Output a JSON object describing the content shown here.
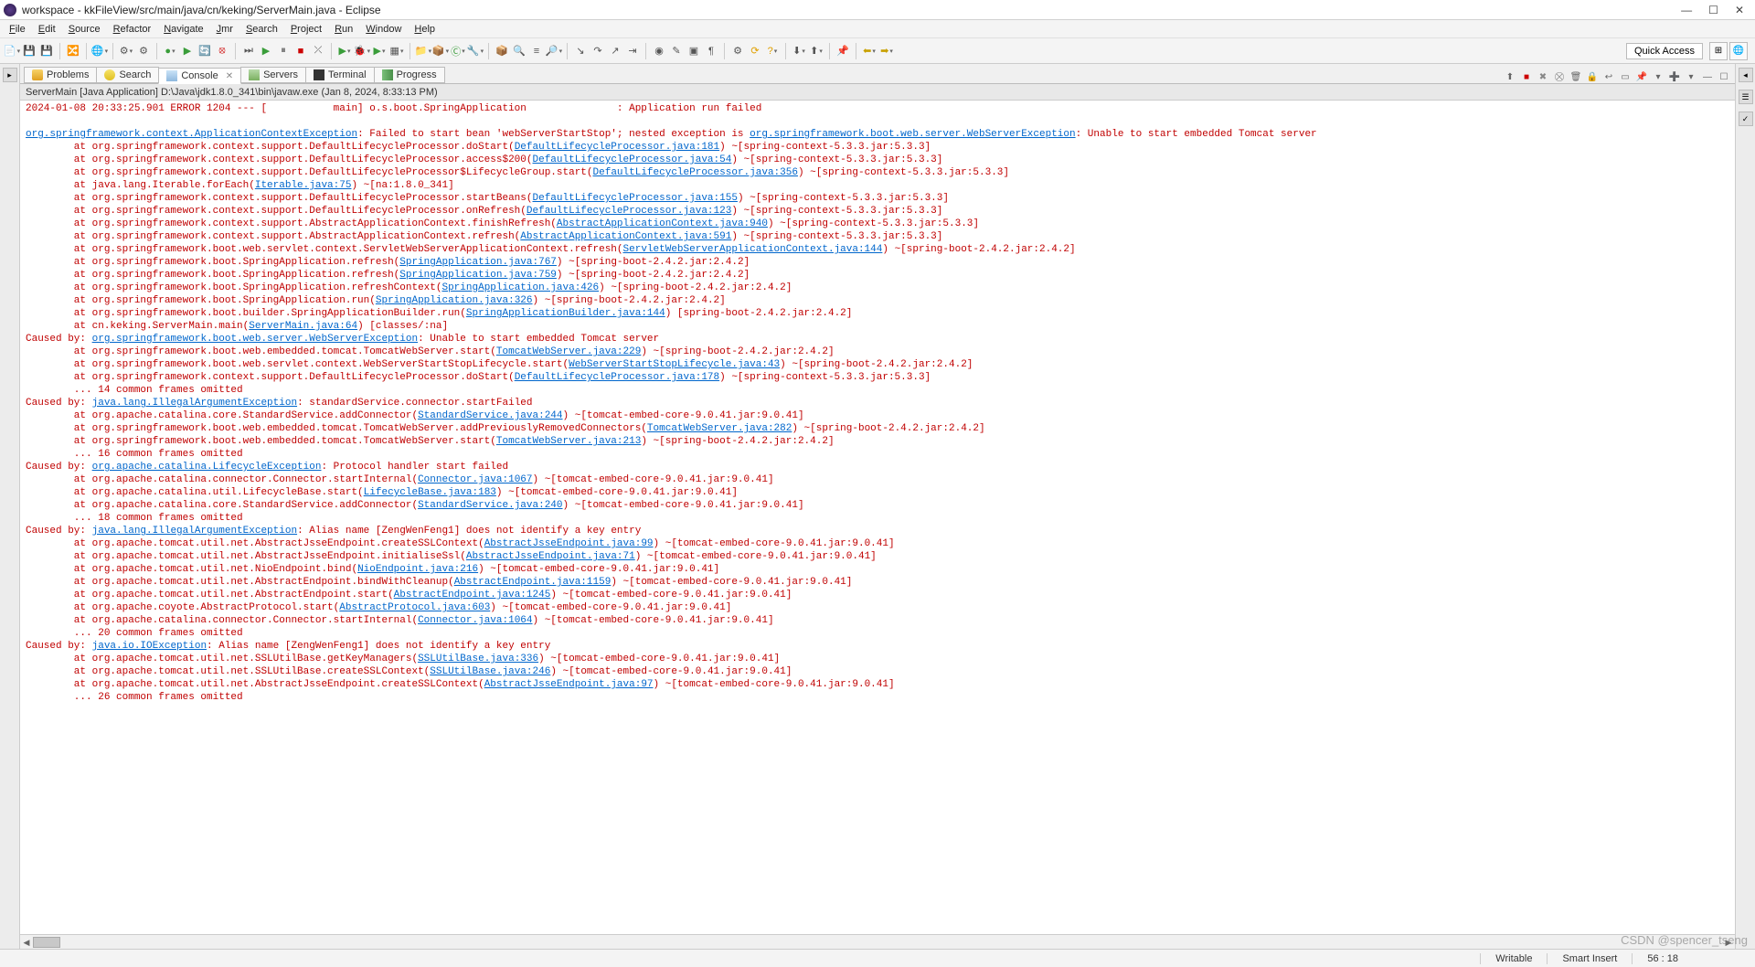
{
  "window": {
    "title": "workspace - kkFileView/src/main/java/cn/keking/ServerMain.java - Eclipse"
  },
  "menu": [
    "File",
    "Edit",
    "Source",
    "Refactor",
    "Navigate",
    "Jmr",
    "Search",
    "Project",
    "Run",
    "Window",
    "Help"
  ],
  "quick_access": "Quick Access",
  "tabs": [
    {
      "label": "Problems",
      "icon": "problems-icon"
    },
    {
      "label": "Search",
      "icon": "search-icon"
    },
    {
      "label": "Console",
      "icon": "console-icon",
      "active": true,
      "closable": true
    },
    {
      "label": "Servers",
      "icon": "servers-icon"
    },
    {
      "label": "Terminal",
      "icon": "terminal-icon"
    },
    {
      "label": "Progress",
      "icon": "progress-icon"
    }
  ],
  "console_info": "ServerMain [Java Application] D:\\Java\\jdk1.8.0_341\\bin\\javaw.exe (Jan 8, 2024, 8:33:13 PM)",
  "status": {
    "writable": "Writable",
    "insert": "Smart Insert",
    "pos": "56 : 18"
  },
  "watermark": "CSDN @spencer_tseng",
  "lines": [
    {
      "segs": [
        {
          "t": "2024-01-08 20:33:25.901 ERROR 1204 --- [           main] o.s.boot.SpringApplication               : Application run failed",
          "c": "err"
        }
      ]
    },
    {
      "segs": [
        {
          "t": "",
          "c": "err"
        }
      ]
    },
    {
      "segs": [
        {
          "t": "org.springframework.context.ApplicationContextException",
          "c": "link"
        },
        {
          "t": ": Failed to start bean 'webServerStartStop'; nested exception is ",
          "c": "err"
        },
        {
          "t": "org.springframework.boot.web.server.WebServerException",
          "c": "link"
        },
        {
          "t": ": Unable to start embedded Tomcat server",
          "c": "err"
        }
      ]
    },
    {
      "segs": [
        {
          "t": "        at org.springframework.context.support.DefaultLifecycleProcessor.doStart(",
          "c": "err"
        },
        {
          "t": "DefaultLifecycleProcessor.java:181",
          "c": "link"
        },
        {
          "t": ") ~[spring-context-5.3.3.jar:5.3.3]",
          "c": "err"
        }
      ]
    },
    {
      "segs": [
        {
          "t": "        at org.springframework.context.support.DefaultLifecycleProcessor.access$200(",
          "c": "err"
        },
        {
          "t": "DefaultLifecycleProcessor.java:54",
          "c": "link"
        },
        {
          "t": ") ~[spring-context-5.3.3.jar:5.3.3]",
          "c": "err"
        }
      ]
    },
    {
      "segs": [
        {
          "t": "        at org.springframework.context.support.DefaultLifecycleProcessor$LifecycleGroup.start(",
          "c": "err"
        },
        {
          "t": "DefaultLifecycleProcessor.java:356",
          "c": "link"
        },
        {
          "t": ") ~[spring-context-5.3.3.jar:5.3.3]",
          "c": "err"
        }
      ]
    },
    {
      "segs": [
        {
          "t": "        at java.lang.Iterable.forEach(",
          "c": "err"
        },
        {
          "t": "Iterable.java:75",
          "c": "link"
        },
        {
          "t": ") ~[na:1.8.0_341]",
          "c": "err"
        }
      ]
    },
    {
      "segs": [
        {
          "t": "        at org.springframework.context.support.DefaultLifecycleProcessor.startBeans(",
          "c": "err"
        },
        {
          "t": "DefaultLifecycleProcessor.java:155",
          "c": "link"
        },
        {
          "t": ") ~[spring-context-5.3.3.jar:5.3.3]",
          "c": "err"
        }
      ]
    },
    {
      "segs": [
        {
          "t": "        at org.springframework.context.support.DefaultLifecycleProcessor.onRefresh(",
          "c": "err"
        },
        {
          "t": "DefaultLifecycleProcessor.java:123",
          "c": "link"
        },
        {
          "t": ") ~[spring-context-5.3.3.jar:5.3.3]",
          "c": "err"
        }
      ]
    },
    {
      "segs": [
        {
          "t": "        at org.springframework.context.support.AbstractApplicationContext.finishRefresh(",
          "c": "err"
        },
        {
          "t": "AbstractApplicationContext.java:940",
          "c": "link"
        },
        {
          "t": ") ~[spring-context-5.3.3.jar:5.3.3]",
          "c": "err"
        }
      ]
    },
    {
      "segs": [
        {
          "t": "        at org.springframework.context.support.AbstractApplicationContext.refresh(",
          "c": "err"
        },
        {
          "t": "AbstractApplicationContext.java:591",
          "c": "link"
        },
        {
          "t": ") ~[spring-context-5.3.3.jar:5.3.3]",
          "c": "err"
        }
      ]
    },
    {
      "segs": [
        {
          "t": "        at org.springframework.boot.web.servlet.context.ServletWebServerApplicationContext.refresh(",
          "c": "err"
        },
        {
          "t": "ServletWebServerApplicationContext.java:144",
          "c": "link"
        },
        {
          "t": ") ~[spring-boot-2.4.2.jar:2.4.2]",
          "c": "err"
        }
      ]
    },
    {
      "segs": [
        {
          "t": "        at org.springframework.boot.SpringApplication.refresh(",
          "c": "err"
        },
        {
          "t": "SpringApplication.java:767",
          "c": "link"
        },
        {
          "t": ") ~[spring-boot-2.4.2.jar:2.4.2]",
          "c": "err"
        }
      ]
    },
    {
      "segs": [
        {
          "t": "        at org.springframework.boot.SpringApplication.refresh(",
          "c": "err"
        },
        {
          "t": "SpringApplication.java:759",
          "c": "link"
        },
        {
          "t": ") ~[spring-boot-2.4.2.jar:2.4.2]",
          "c": "err"
        }
      ]
    },
    {
      "segs": [
        {
          "t": "        at org.springframework.boot.SpringApplication.refreshContext(",
          "c": "err"
        },
        {
          "t": "SpringApplication.java:426",
          "c": "link"
        },
        {
          "t": ") ~[spring-boot-2.4.2.jar:2.4.2]",
          "c": "err"
        }
      ]
    },
    {
      "segs": [
        {
          "t": "        at org.springframework.boot.SpringApplication.run(",
          "c": "err"
        },
        {
          "t": "SpringApplication.java:326",
          "c": "link"
        },
        {
          "t": ") ~[spring-boot-2.4.2.jar:2.4.2]",
          "c": "err"
        }
      ]
    },
    {
      "segs": [
        {
          "t": "        at org.springframework.boot.builder.SpringApplicationBuilder.run(",
          "c": "err"
        },
        {
          "t": "SpringApplicationBuilder.java:144",
          "c": "link"
        },
        {
          "t": ") [spring-boot-2.4.2.jar:2.4.2]",
          "c": "err"
        }
      ]
    },
    {
      "segs": [
        {
          "t": "        at cn.keking.ServerMain.main(",
          "c": "err"
        },
        {
          "t": "ServerMain.java:64",
          "c": "link"
        },
        {
          "t": ") [classes/:na]",
          "c": "err"
        }
      ]
    },
    {
      "segs": [
        {
          "t": "Caused by: ",
          "c": "err"
        },
        {
          "t": "org.springframework.boot.web.server.WebServerException",
          "c": "link"
        },
        {
          "t": ": Unable to start embedded Tomcat server",
          "c": "err"
        }
      ]
    },
    {
      "segs": [
        {
          "t": "        at org.springframework.boot.web.embedded.tomcat.TomcatWebServer.start(",
          "c": "err"
        },
        {
          "t": "TomcatWebServer.java:229",
          "c": "link"
        },
        {
          "t": ") ~[spring-boot-2.4.2.jar:2.4.2]",
          "c": "err"
        }
      ]
    },
    {
      "segs": [
        {
          "t": "        at org.springframework.boot.web.servlet.context.WebServerStartStopLifecycle.start(",
          "c": "err"
        },
        {
          "t": "WebServerStartStopLifecycle.java:43",
          "c": "link"
        },
        {
          "t": ") ~[spring-boot-2.4.2.jar:2.4.2]",
          "c": "err"
        }
      ]
    },
    {
      "segs": [
        {
          "t": "        at org.springframework.context.support.DefaultLifecycleProcessor.doStart(",
          "c": "err"
        },
        {
          "t": "DefaultLifecycleProcessor.java:178",
          "c": "link"
        },
        {
          "t": ") ~[spring-context-5.3.3.jar:5.3.3]",
          "c": "err"
        }
      ]
    },
    {
      "segs": [
        {
          "t": "        ... 14 common frames omitted",
          "c": "err"
        }
      ]
    },
    {
      "segs": [
        {
          "t": "Caused by: ",
          "c": "err"
        },
        {
          "t": "java.lang.IllegalArgumentException",
          "c": "link"
        },
        {
          "t": ": standardService.connector.startFailed",
          "c": "err"
        }
      ]
    },
    {
      "segs": [
        {
          "t": "        at org.apache.catalina.core.StandardService.addConnector(",
          "c": "err"
        },
        {
          "t": "StandardService.java:244",
          "c": "link"
        },
        {
          "t": ") ~[tomcat-embed-core-9.0.41.jar:9.0.41]",
          "c": "err"
        }
      ]
    },
    {
      "segs": [
        {
          "t": "        at org.springframework.boot.web.embedded.tomcat.TomcatWebServer.addPreviouslyRemovedConnectors(",
          "c": "err"
        },
        {
          "t": "TomcatWebServer.java:282",
          "c": "link"
        },
        {
          "t": ") ~[spring-boot-2.4.2.jar:2.4.2]",
          "c": "err"
        }
      ]
    },
    {
      "segs": [
        {
          "t": "        at org.springframework.boot.web.embedded.tomcat.TomcatWebServer.start(",
          "c": "err"
        },
        {
          "t": "TomcatWebServer.java:213",
          "c": "link"
        },
        {
          "t": ") ~[spring-boot-2.4.2.jar:2.4.2]",
          "c": "err"
        }
      ]
    },
    {
      "segs": [
        {
          "t": "        ... 16 common frames omitted",
          "c": "err"
        }
      ]
    },
    {
      "segs": [
        {
          "t": "Caused by: ",
          "c": "err"
        },
        {
          "t": "org.apache.catalina.LifecycleException",
          "c": "link"
        },
        {
          "t": ": Protocol handler start failed",
          "c": "err"
        }
      ]
    },
    {
      "segs": [
        {
          "t": "        at org.apache.catalina.connector.Connector.startInternal(",
          "c": "err"
        },
        {
          "t": "Connector.java:1067",
          "c": "link"
        },
        {
          "t": ") ~[tomcat-embed-core-9.0.41.jar:9.0.41]",
          "c": "err"
        }
      ]
    },
    {
      "segs": [
        {
          "t": "        at org.apache.catalina.util.LifecycleBase.start(",
          "c": "err"
        },
        {
          "t": "LifecycleBase.java:183",
          "c": "link"
        },
        {
          "t": ") ~[tomcat-embed-core-9.0.41.jar:9.0.41]",
          "c": "err"
        }
      ]
    },
    {
      "segs": [
        {
          "t": "        at org.apache.catalina.core.StandardService.addConnector(",
          "c": "err"
        },
        {
          "t": "StandardService.java:240",
          "c": "link"
        },
        {
          "t": ") ~[tomcat-embed-core-9.0.41.jar:9.0.41]",
          "c": "err"
        }
      ]
    },
    {
      "segs": [
        {
          "t": "        ... 18 common frames omitted",
          "c": "err"
        }
      ]
    },
    {
      "segs": [
        {
          "t": "Caused by: ",
          "c": "err"
        },
        {
          "t": "java.lang.IllegalArgumentException",
          "c": "link"
        },
        {
          "t": ": Alias name [ZengWenFeng1] does not identify a key entry",
          "c": "err"
        }
      ]
    },
    {
      "segs": [
        {
          "t": "        at org.apache.tomcat.util.net.AbstractJsseEndpoint.createSSLContext(",
          "c": "err"
        },
        {
          "t": "AbstractJsseEndpoint.java:99",
          "c": "link"
        },
        {
          "t": ") ~[tomcat-embed-core-9.0.41.jar:9.0.41]",
          "c": "err"
        }
      ]
    },
    {
      "segs": [
        {
          "t": "        at org.apache.tomcat.util.net.AbstractJsseEndpoint.initialiseSsl(",
          "c": "err"
        },
        {
          "t": "AbstractJsseEndpoint.java:71",
          "c": "link"
        },
        {
          "t": ") ~[tomcat-embed-core-9.0.41.jar:9.0.41]",
          "c": "err"
        }
      ]
    },
    {
      "segs": [
        {
          "t": "        at org.apache.tomcat.util.net.NioEndpoint.bind(",
          "c": "err"
        },
        {
          "t": "NioEndpoint.java:216",
          "c": "link"
        },
        {
          "t": ") ~[tomcat-embed-core-9.0.41.jar:9.0.41]",
          "c": "err"
        }
      ]
    },
    {
      "segs": [
        {
          "t": "        at org.apache.tomcat.util.net.AbstractEndpoint.bindWithCleanup(",
          "c": "err"
        },
        {
          "t": "AbstractEndpoint.java:1159",
          "c": "link"
        },
        {
          "t": ") ~[tomcat-embed-core-9.0.41.jar:9.0.41]",
          "c": "err"
        }
      ]
    },
    {
      "segs": [
        {
          "t": "        at org.apache.tomcat.util.net.AbstractEndpoint.start(",
          "c": "err"
        },
        {
          "t": "AbstractEndpoint.java:1245",
          "c": "link"
        },
        {
          "t": ") ~[tomcat-embed-core-9.0.41.jar:9.0.41]",
          "c": "err"
        }
      ]
    },
    {
      "segs": [
        {
          "t": "        at org.apache.coyote.AbstractProtocol.start(",
          "c": "err"
        },
        {
          "t": "AbstractProtocol.java:603",
          "c": "link"
        },
        {
          "t": ") ~[tomcat-embed-core-9.0.41.jar:9.0.41]",
          "c": "err"
        }
      ]
    },
    {
      "segs": [
        {
          "t": "        at org.apache.catalina.connector.Connector.startInternal(",
          "c": "err"
        },
        {
          "t": "Connector.java:1064",
          "c": "link"
        },
        {
          "t": ") ~[tomcat-embed-core-9.0.41.jar:9.0.41]",
          "c": "err"
        }
      ]
    },
    {
      "segs": [
        {
          "t": "        ... 20 common frames omitted",
          "c": "err"
        }
      ]
    },
    {
      "segs": [
        {
          "t": "Caused by: ",
          "c": "err"
        },
        {
          "t": "java.io.IOException",
          "c": "link"
        },
        {
          "t": ": Alias name [ZengWenFeng1] does not identify a key entry",
          "c": "err"
        }
      ]
    },
    {
      "segs": [
        {
          "t": "        at org.apache.tomcat.util.net.SSLUtilBase.getKeyManagers(",
          "c": "err"
        },
        {
          "t": "SSLUtilBase.java:336",
          "c": "link"
        },
        {
          "t": ") ~[tomcat-embed-core-9.0.41.jar:9.0.41]",
          "c": "err"
        }
      ]
    },
    {
      "segs": [
        {
          "t": "        at org.apache.tomcat.util.net.SSLUtilBase.createSSLContext(",
          "c": "err"
        },
        {
          "t": "SSLUtilBase.java:246",
          "c": "link"
        },
        {
          "t": ") ~[tomcat-embed-core-9.0.41.jar:9.0.41]",
          "c": "err"
        }
      ]
    },
    {
      "segs": [
        {
          "t": "        at org.apache.tomcat.util.net.AbstractJsseEndpoint.createSSLContext(",
          "c": "err"
        },
        {
          "t": "AbstractJsseEndpoint.java:97",
          "c": "link"
        },
        {
          "t": ") ~[tomcat-embed-core-9.0.41.jar:9.0.41]",
          "c": "err"
        }
      ]
    },
    {
      "segs": [
        {
          "t": "        ... 26 common frames omitted",
          "c": "err"
        }
      ]
    },
    {
      "segs": [
        {
          "t": "",
          "c": "err"
        }
      ]
    }
  ]
}
